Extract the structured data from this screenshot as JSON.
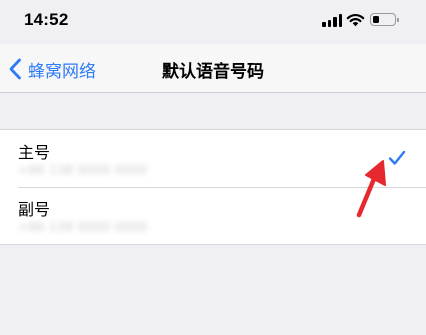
{
  "status_bar": {
    "time": "14:52",
    "signal_icon": "cellular-signal-icon",
    "wifi_icon": "wifi-icon",
    "battery_icon": "battery-icon",
    "battery_level": 0.3
  },
  "nav": {
    "back_icon": "chevron-left-icon",
    "back_label": "蜂窝网络",
    "title": "默认语音号码"
  },
  "lines": [
    {
      "title": "主号",
      "number": "+86 138 0000 0000",
      "selected": true
    },
    {
      "title": "副号",
      "number": "+86 139 0000 0000",
      "selected": false
    }
  ],
  "colors": {
    "accent": "#2f7bf5",
    "background": "#efeff4",
    "annotation": "#e5292f"
  },
  "annotation": {
    "icon": "red-arrow-icon",
    "points_to": "checkmark on 主号"
  }
}
